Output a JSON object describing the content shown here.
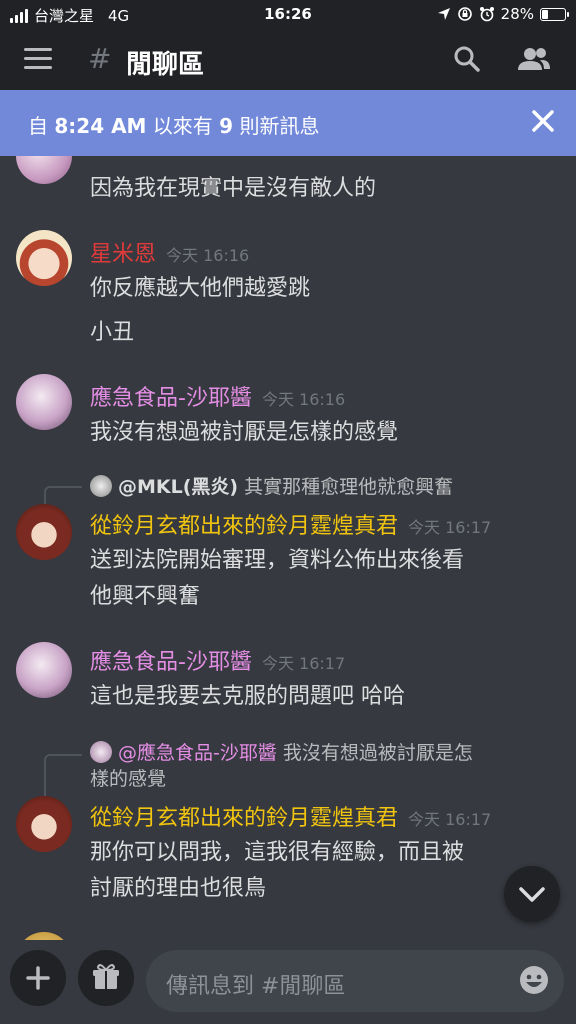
{
  "status_bar": {
    "carrier": "台灣之星",
    "network": "4G",
    "time": "16:26",
    "battery": "28%",
    "battery_level": 0.28
  },
  "header": {
    "hash": "#",
    "channel_name": "閒聊區",
    "icons": [
      "menu-icon",
      "search-icon",
      "members-icon"
    ]
  },
  "banner": {
    "text_prefix": "自 ",
    "time": "8:24 AM",
    "text_mid": " 以來有 ",
    "count": "9",
    "text_suffix": " 則新訊息"
  },
  "colors": {
    "background": "#36393f",
    "header": "#202225",
    "banner": "#7289da",
    "red_name": "#e03b3b",
    "pink_name": "#e58ee5",
    "gold_name": "#f1c40f"
  },
  "messages": [
    {
      "lines": [
        "因為我在現實中是沒有敵人的"
      ]
    },
    {
      "author": "星米恩",
      "time": "今天 16:16",
      "lines": [
        "你反應越大他們越愛跳",
        "小丑"
      ]
    },
    {
      "author": "應急食品-沙耶醬",
      "time": "今天 16:16",
      "lines": [
        "我沒有想過被討厭是怎樣的感覺"
      ]
    },
    {
      "reply_to": "@MKL(黑炎)",
      "reply_text": "其實那種愈理他就愈興奮",
      "author": "從鈴月玄都出來的鈴月霆煌真君",
      "time": "今天 16:17",
      "lines": [
        "送到法院開始審理，資料公佈出來後看",
        "他興不興奮"
      ]
    },
    {
      "author": "應急食品-沙耶醬",
      "time": "今天 16:17",
      "lines": [
        "這也是我要去克服的問題吧 哈哈"
      ]
    },
    {
      "reply_to": "@應急食品-沙耶醬",
      "reply_text": "我沒有想過被討厭是怎",
      "reply_text2": "樣的感覺",
      "author": "從鈴月玄都出來的鈴月霆煌真君",
      "time": "今天 16:17",
      "lines": [
        "那你可以問我，這我很有經驗，而且被",
        "討厭的理由也很鳥"
      ]
    }
  ],
  "composer": {
    "placeholder": "傳訊息到 #閒聊區",
    "icons": [
      "plus-icon",
      "gift-icon",
      "emoji-icon"
    ]
  }
}
